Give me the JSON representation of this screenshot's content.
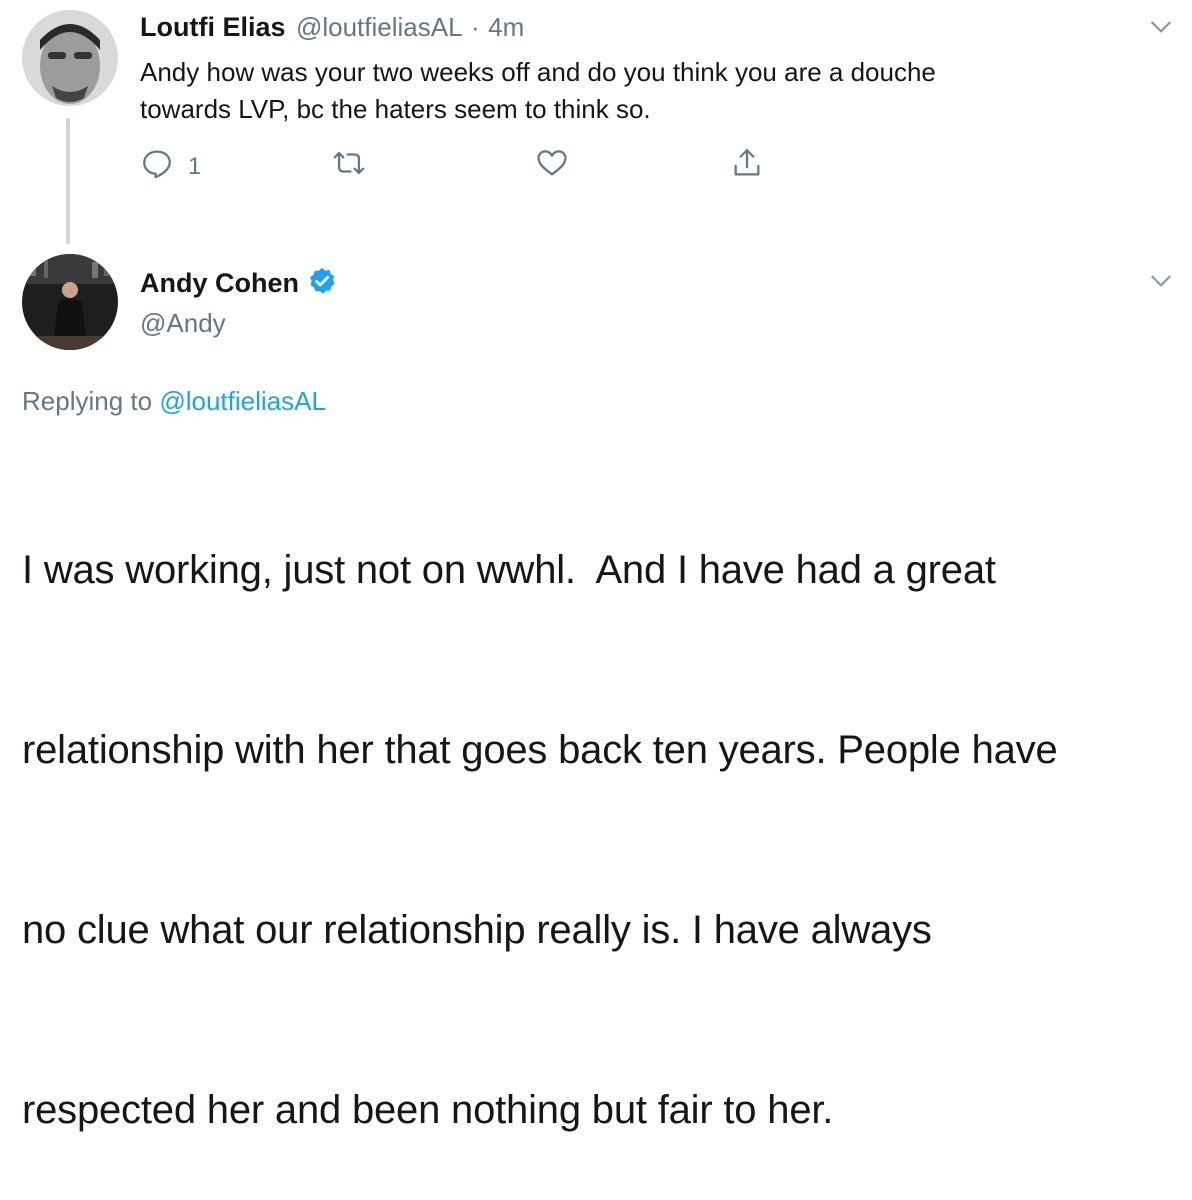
{
  "tweet1": {
    "name": "Loutfi Elias",
    "handle": "@loutfieliasAL",
    "separator": "·",
    "time": "4m",
    "text_line1": "Andy how was your two weeks off and do you think you are a douche",
    "text_line2": "towards LVP, bc the haters seem to think so.",
    "reply_count": "1",
    "icons": [
      "reply-icon",
      "retweet-icon",
      "like-icon",
      "share-icon",
      "chevron-down-icon"
    ]
  },
  "tweet2": {
    "name": "Andy Cohen",
    "handle": "@Andy",
    "verified": true,
    "replying_prefix": "Replying to",
    "replying_handle": "@loutfieliasAL",
    "text_line1": "I was working, just not on wwhl.  And I have had a great",
    "text_line2": "relationship with her that goes back ten years. People have",
    "text_line3": "no clue what our relationship really is. I have always",
    "text_line4": "respected her and been nothing but fair to her."
  },
  "colors": {
    "text": "#14171a",
    "secondary": "#657786",
    "link": "#1da1f2",
    "thread_line": "#cdd6dd"
  }
}
